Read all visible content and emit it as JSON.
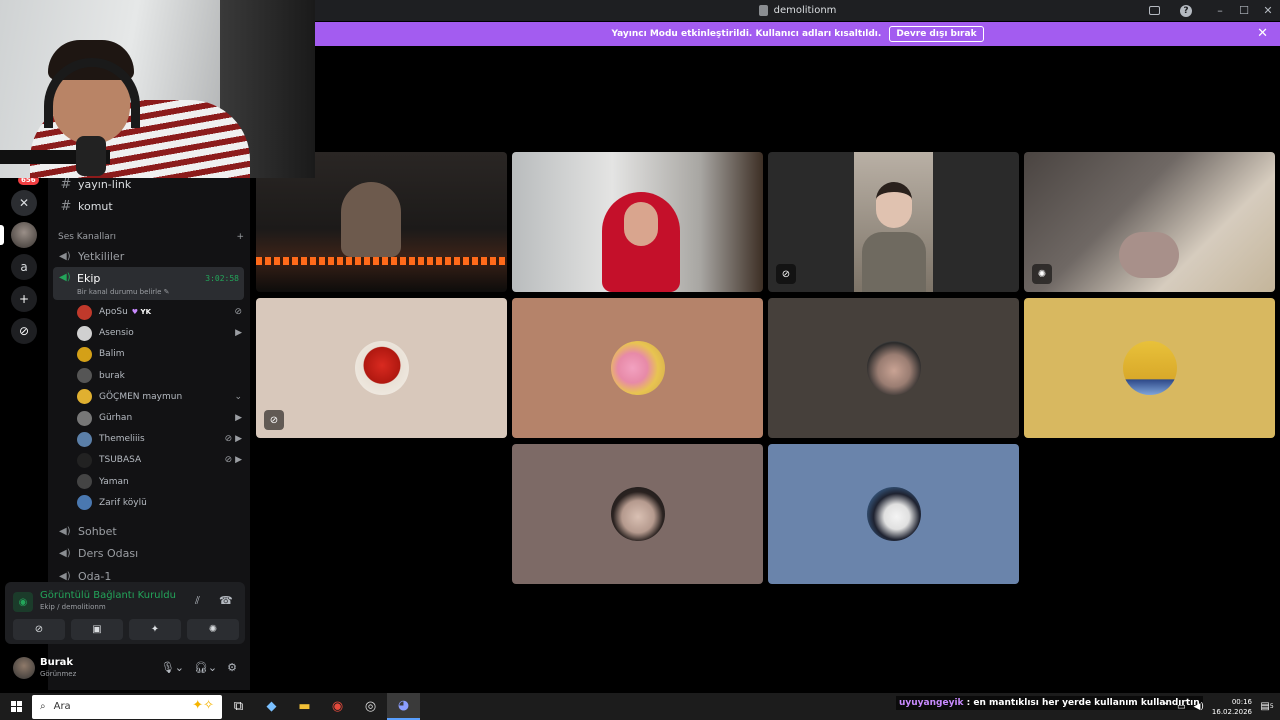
{
  "window": {
    "title": "demolitionm"
  },
  "banner": {
    "text": "Yayıncı Modu etkinleştirildi. Kullanıcı adları kısaltıldı.",
    "button": "Devre dışı bırak",
    "close": "✕"
  },
  "rail": {
    "badge": "656",
    "server_letter": "a",
    "add": "+",
    "explore": "⊘"
  },
  "channels": {
    "text": [
      {
        "name": "yayın-link"
      },
      {
        "name": "komut"
      }
    ],
    "voice_section": "Ses Kanalları",
    "voice_section_add": "+",
    "voice_before": [
      {
        "name": "Yetkililer"
      }
    ],
    "active": {
      "name": "Ekip",
      "time": "3:02:58",
      "status": "Bir kanal durumu belirle ✎"
    },
    "members": [
      {
        "name": "ApoSu",
        "tag": "YK",
        "icons": "⊘",
        "color": "#c0392b"
      },
      {
        "name": "Asensio",
        "icons": "▶",
        "color": "#d0d0d0"
      },
      {
        "name": "Balim",
        "icons": "",
        "color": "#d4a017"
      },
      {
        "name": "burak",
        "icons": "",
        "color": "#555"
      },
      {
        "name": "GÖÇMEN maymun",
        "icons": "⌄",
        "color": "#e0b030"
      },
      {
        "name": "Gürhan",
        "icons": "▶",
        "color": "#777"
      },
      {
        "name": "Themeliiis",
        "icons": "⊘ ▶",
        "color": "#5b7fa8"
      },
      {
        "name": "TSUBASA",
        "icons": "⊘ ▶",
        "color": "#222"
      },
      {
        "name": "Yaman",
        "icons": "",
        "color": "#444"
      },
      {
        "name": "Zarif köylü",
        "icons": "",
        "color": "#4a78b0"
      }
    ],
    "voice_after": [
      {
        "name": "Sohbet"
      },
      {
        "name": "Ders Odası"
      },
      {
        "name": "Oda-1"
      }
    ]
  },
  "voice_panel": {
    "title": "Görüntülü Bağlantı Kuruldu",
    "subtitle": "Ekip / demolitionm",
    "buttons": [
      "⊘",
      "▣",
      "✦",
      "✺"
    ]
  },
  "user": {
    "name": "Burak",
    "status": "Görünmez"
  },
  "taskbar": {
    "search_placeholder": "Ara",
    "ticker_user": "uyuyangeyik",
    "ticker_text": ": en mantıklısı her yerde kullanım kullandırtın",
    "time": "00:16",
    "date": "16.02.2026",
    "notif_count": "5"
  },
  "colors": {
    "banner": "#a35cf0",
    "connected": "#23a55a",
    "tile_beige": "#d8c8bb",
    "tile_brown": "#b5836a",
    "tile_dark": "#46403b",
    "tile_yellow": "#d8b860",
    "tile_mauve": "#7d6a66",
    "tile_blue": "#6a84ab"
  }
}
